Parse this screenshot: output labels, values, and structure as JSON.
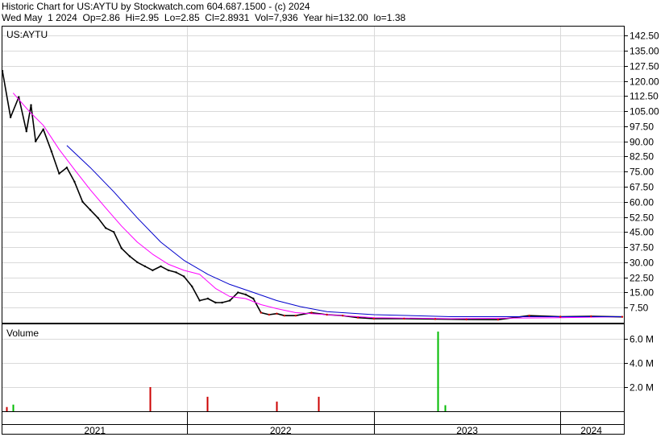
{
  "header": {
    "line1": "Historic Chart for US:AYTU by Stockwatch.com 604.687.1500 - (c) 2024",
    "line2": "Wed May  1 2024  Op=2.86  Hi=2.95  Lo=2.85  Cl=2.8931  Vol=7,936  Year hi=132.00  lo=1.38"
  },
  "symbol_label": "US:AYTU",
  "volume_label": "Volume",
  "chart_data": [
    {
      "type": "line",
      "title": "US:AYTU",
      "ylim": [
        0,
        147
      ],
      "y_ticks": [
        "142.50",
        "135.00",
        "127.50",
        "120.00",
        "112.50",
        "105.00",
        "97.50",
        "90.00",
        "82.50",
        "75.00",
        "67.50",
        "60.00",
        "52.50",
        "45.00",
        "37.50",
        "30.00",
        "22.50",
        "15.00",
        "7.50"
      ],
      "x_ticks": [
        "2021",
        "2022",
        "2023",
        "2024"
      ],
      "x_range": [
        "2021-01-04",
        "2024-05-01"
      ],
      "grid": true,
      "colors": {
        "price": "#000000",
        "ma_short": "#ff00ff",
        "ma_long": "#0000cc",
        "price_late": "#cc0000"
      },
      "series": [
        {
          "key": "price",
          "x": [
            "2021-01-04",
            "2021-01-20",
            "2021-02-05",
            "2021-02-20",
            "2021-03-01",
            "2021-03-10",
            "2021-03-25",
            "2021-04-10",
            "2021-04-25",
            "2021-05-10",
            "2021-05-25",
            "2021-06-10",
            "2021-06-25",
            "2021-07-10",
            "2021-07-25",
            "2021-08-10",
            "2021-08-25",
            "2021-09-10",
            "2021-09-25",
            "2021-10-10",
            "2021-10-25",
            "2021-11-10",
            "2021-11-25",
            "2021-12-10",
            "2021-12-25",
            "2022-01-10",
            "2022-01-25",
            "2022-02-10",
            "2022-02-25",
            "2022-03-10",
            "2022-03-25",
            "2022-04-10",
            "2022-04-25",
            "2022-05-10",
            "2022-05-25",
            "2022-06-10",
            "2022-06-25",
            "2022-07-10",
            "2022-08-01",
            "2022-09-01",
            "2022-10-01",
            "2022-11-01",
            "2022-12-01",
            "2023-01-01",
            "2023-03-01",
            "2023-05-01",
            "2023-07-01",
            "2023-09-01",
            "2023-11-01",
            "2024-01-01",
            "2024-03-01",
            "2024-05-01"
          ],
          "values": [
            125,
            102,
            112,
            95,
            108,
            90,
            96,
            85,
            74,
            77,
            70,
            60,
            56,
            52,
            47,
            45,
            37,
            33,
            30,
            28,
            26,
            28,
            26,
            25,
            23,
            18,
            11,
            12,
            10,
            10,
            11,
            15,
            14,
            12,
            5,
            4,
            4.5,
            3.5,
            3.5,
            5,
            4,
            3.5,
            2.5,
            2,
            2,
            1.8,
            1.6,
            1.5,
            3.5,
            3,
            3.2,
            2.9
          ]
        },
        {
          "key": "ma_short",
          "x": [
            "2021-01-25",
            "2021-02-25",
            "2021-03-25",
            "2021-04-25",
            "2021-05-25",
            "2021-06-25",
            "2021-07-25",
            "2021-08-25",
            "2021-09-25",
            "2021-10-25",
            "2021-11-25",
            "2021-12-25",
            "2022-01-25",
            "2022-02-25",
            "2022-03-25",
            "2022-04-25",
            "2022-05-25",
            "2022-06-25",
            "2022-08-01",
            "2022-10-01",
            "2023-01-01",
            "2023-06-01",
            "2024-01-01",
            "2024-05-01"
          ],
          "values": [
            114,
            105,
            98,
            86,
            76,
            66,
            57,
            48,
            40,
            34,
            29,
            26,
            24,
            17,
            13,
            12,
            9,
            7,
            5,
            4,
            2.5,
            2,
            2.5,
            3
          ]
        },
        {
          "key": "ma_long",
          "x": [
            "2021-05-10",
            "2021-06-25",
            "2021-08-10",
            "2021-09-25",
            "2021-11-10",
            "2021-12-25",
            "2022-02-10",
            "2022-03-25",
            "2022-05-10",
            "2022-06-25",
            "2022-08-10",
            "2022-10-01",
            "2023-01-01",
            "2023-06-01",
            "2024-01-01",
            "2024-05-01"
          ],
          "values": [
            88,
            77,
            65,
            52,
            40,
            31,
            24,
            19,
            15,
            11,
            8,
            5.5,
            4,
            3,
            3,
            3
          ]
        }
      ]
    },
    {
      "type": "bar",
      "title": "Volume",
      "ylim": [
        0,
        7.2
      ],
      "y_unit": "M",
      "y_ticks": [
        "6.0 M",
        "4.0 M",
        "2.0 M"
      ],
      "colors": {
        "up": "#00bb00",
        "down": "#cc0000"
      },
      "spikes": [
        {
          "x": "2021-01-25",
          "value": 0.55,
          "dir": "up"
        },
        {
          "x": "2021-01-12",
          "value": 0.35,
          "dir": "down"
        },
        {
          "x": "2021-10-20",
          "value": 2.0,
          "dir": "down"
        },
        {
          "x": "2022-02-08",
          "value": 1.2,
          "dir": "down"
        },
        {
          "x": "2022-06-25",
          "value": 0.8,
          "dir": "down"
        },
        {
          "x": "2022-09-15",
          "value": 1.2,
          "dir": "down"
        },
        {
          "x": "2023-05-05",
          "value": 6.6,
          "dir": "up"
        },
        {
          "x": "2023-05-20",
          "value": 0.5,
          "dir": "up"
        }
      ]
    }
  ]
}
